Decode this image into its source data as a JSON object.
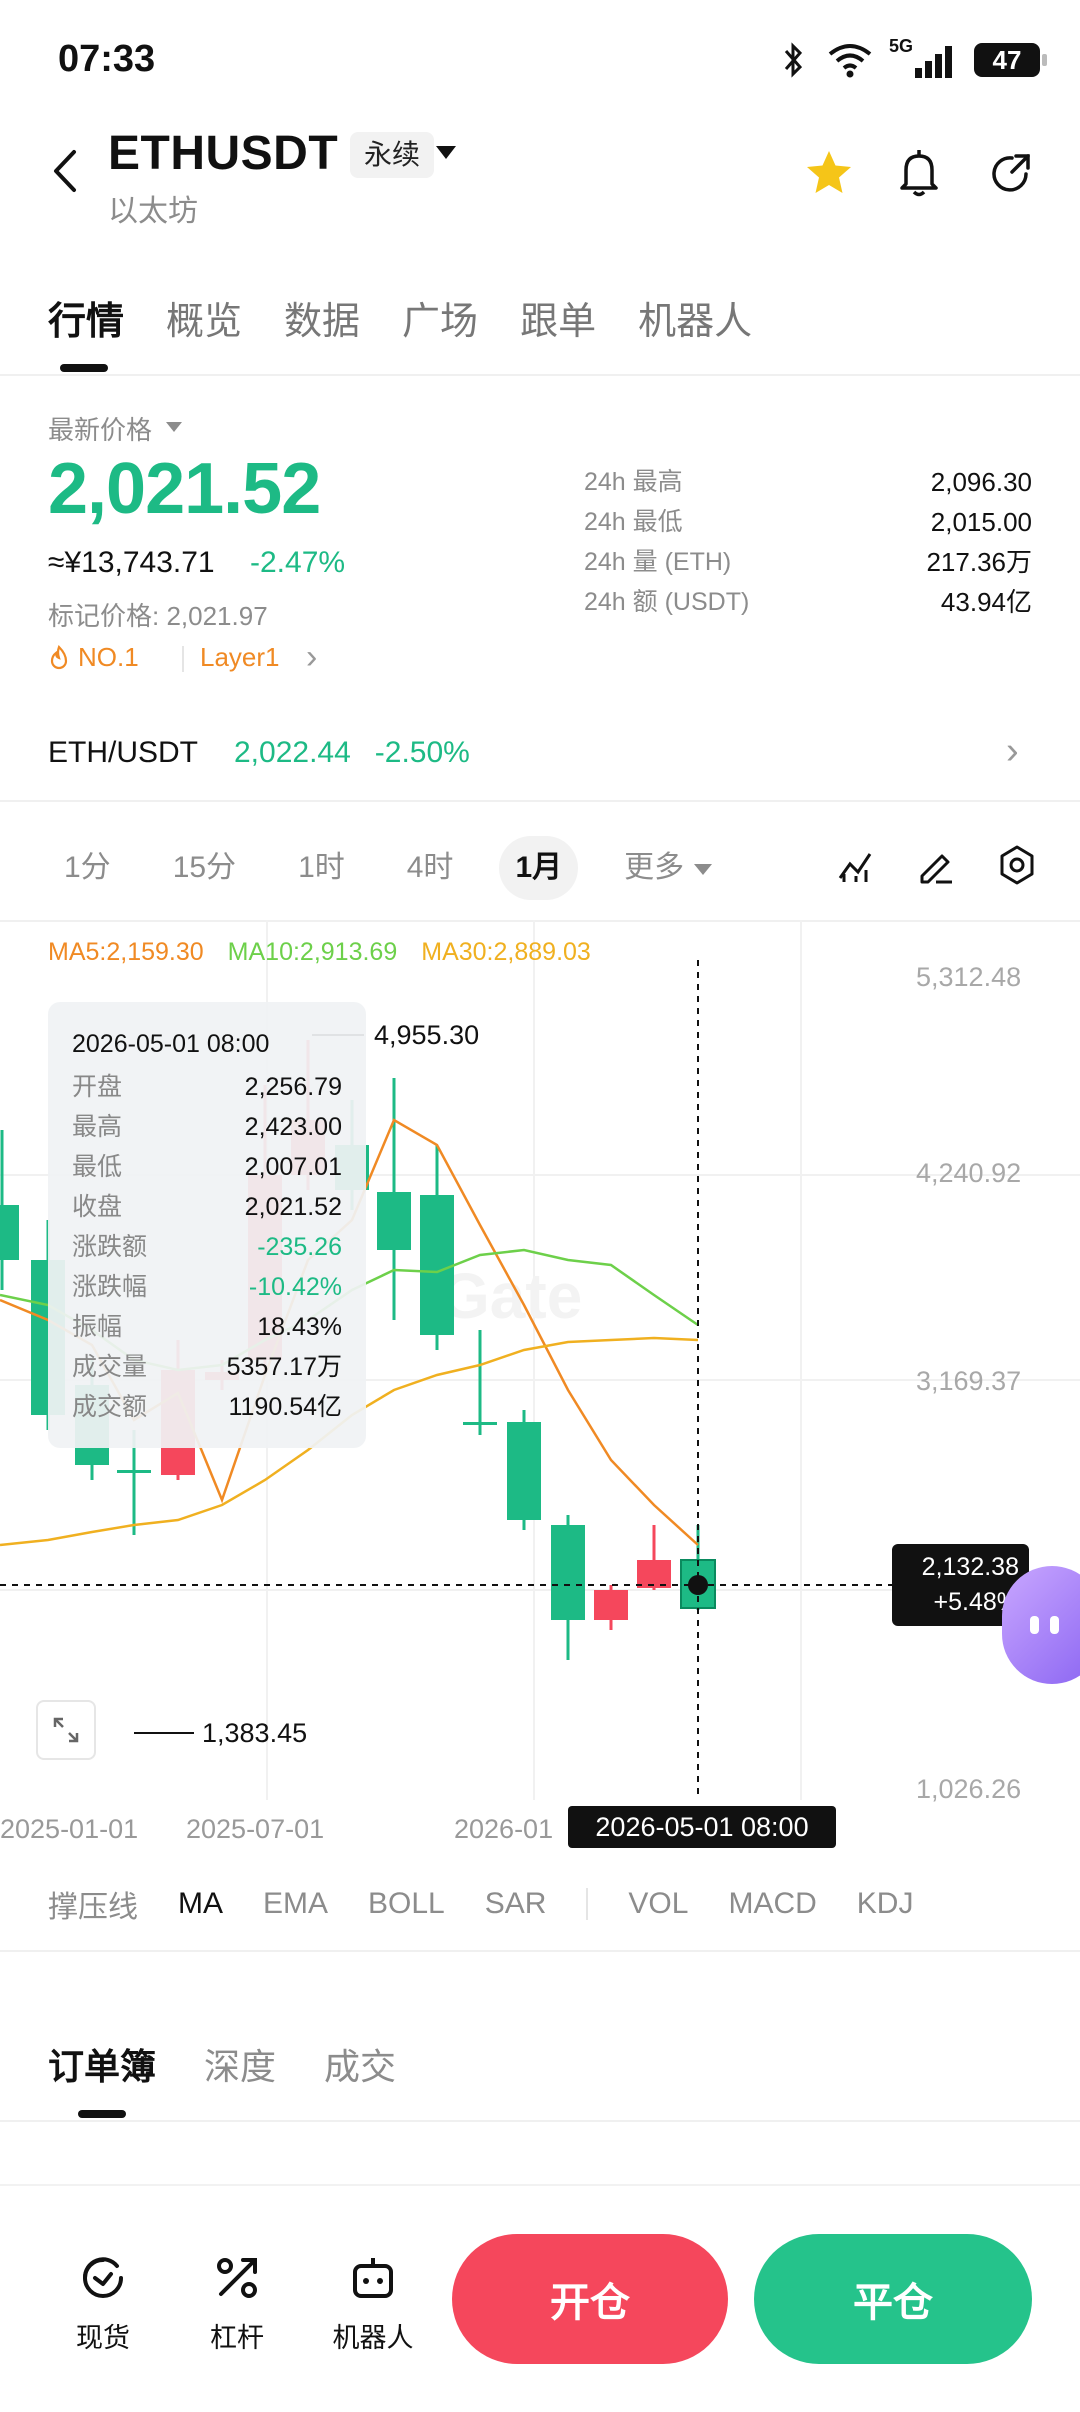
{
  "status_bar": {
    "time": "07:33",
    "battery": "47",
    "network": "5G"
  },
  "header": {
    "pair": "ETHUSDT",
    "contract_type": "永续",
    "subtitle": "以太坊",
    "favorited": true
  },
  "top_tabs": [
    "行情",
    "概览",
    "数据",
    "广场",
    "跟单",
    "机器人"
  ],
  "price": {
    "label": "最新价格",
    "last": "2,021.52",
    "cny": "≈¥13,743.71",
    "change_pct": "-2.47%",
    "mark_price": "标记价格: 2,021.97",
    "rank": "NO.1",
    "sector": "Layer1"
  },
  "stats": [
    {
      "label": "24h  最高",
      "value": "2,096.30"
    },
    {
      "label": "24h  最低",
      "value": "2,015.00"
    },
    {
      "label": "24h  量 (ETH)",
      "value": "217.36万"
    },
    {
      "label": "24h  额 (USDT)",
      "value": "43.94亿"
    }
  ],
  "spot": {
    "pair": "ETH/USDT",
    "price": "2,022.44",
    "change": "-2.50%"
  },
  "intervals": {
    "items": [
      "1分",
      "15分",
      "1时",
      "4时",
      "1月"
    ],
    "active": "1月",
    "more": "更多"
  },
  "ma_legend": {
    "ma5": "MA5:2,159.30",
    "ma10": "MA10:2,913.69",
    "ma30": "MA30:2,889.03"
  },
  "tooltip": {
    "date": "2026-05-01 08:00",
    "rows": [
      {
        "label": "开盘",
        "value": "2,256.79"
      },
      {
        "label": "最高",
        "value": "2,423.00"
      },
      {
        "label": "最低",
        "value": "2,007.01"
      },
      {
        "label": "收盘",
        "value": "2,021.52"
      },
      {
        "label": "涨跌额",
        "value": "-235.26"
      },
      {
        "label": "涨跌幅",
        "value": "-10.42%"
      },
      {
        "label": "振幅",
        "value": "18.43%"
      },
      {
        "label": "成交量",
        "value": "5357.17万"
      },
      {
        "label": "成交额",
        "value": "1190.54亿"
      }
    ]
  },
  "chart_data": {
    "type": "candlestick",
    "y_ticks": [
      "5,312.48",
      "4,240.92",
      "3,169.37",
      "1,026.26"
    ],
    "x_ticks": [
      "2025-01-01",
      "2025-07-01",
      "2026-01"
    ],
    "max_marker": "4,955.30",
    "min_marker": "1,383.45",
    "current_price": "2,132.38",
    "current_change": "+5.48%",
    "crosshair_time": "2026-05-01 08:00",
    "colors": {
      "up": "#f5475c",
      "down": "#1dba85",
      "ma5": "#f08a24",
      "ma10": "#6dd04a",
      "ma30": "#f0b020"
    }
  },
  "indicators": {
    "main": [
      "撑压线",
      "MA",
      "EMA",
      "BOLL",
      "SAR"
    ],
    "sub": [
      "VOL",
      "MACD",
      "KDJ"
    ],
    "active": "MA"
  },
  "book_tabs": [
    "订单簿",
    "深度",
    "成交"
  ],
  "bottom": {
    "spot": "现货",
    "leverage": "杠杆",
    "bot": "机器人",
    "open": "开仓",
    "close": "平仓"
  }
}
